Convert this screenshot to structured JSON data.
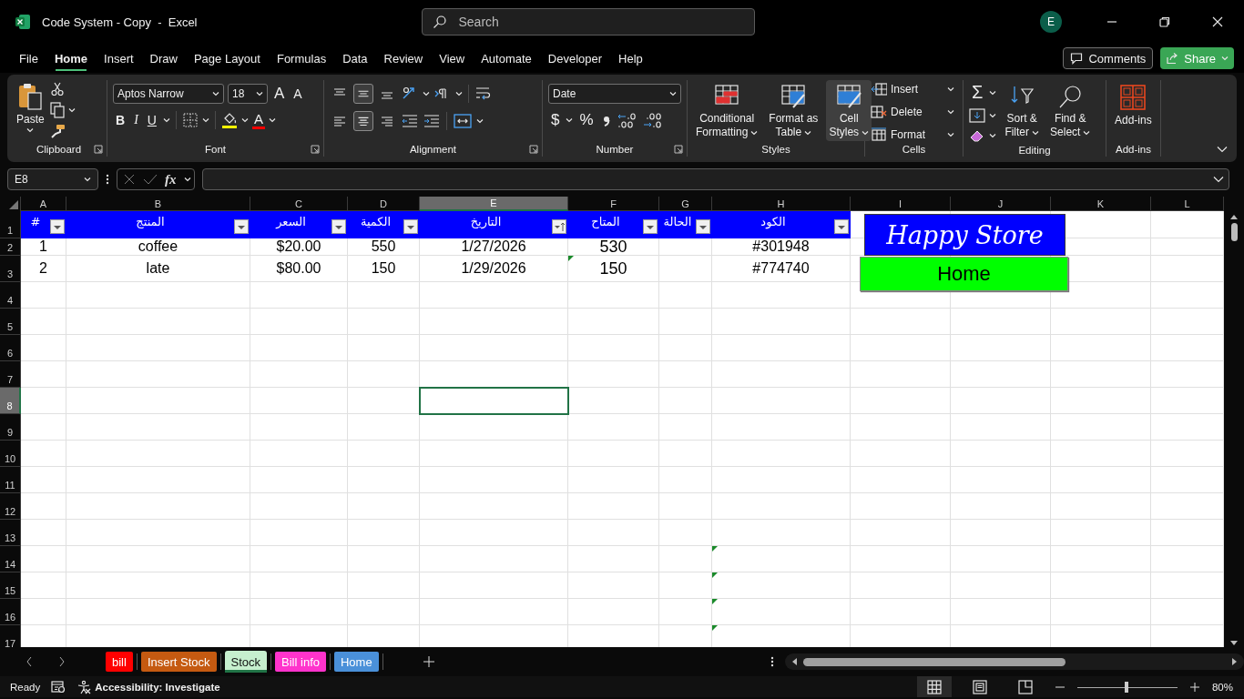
{
  "window": {
    "title": "Code System - Copy  -  Excel",
    "search_placeholder": "Search",
    "user_initial": "E"
  },
  "menu": {
    "tabs": [
      {
        "label": "File",
        "selected": false
      },
      {
        "label": "Home",
        "selected": true
      },
      {
        "label": "Insert",
        "selected": false
      },
      {
        "label": "Draw",
        "selected": false
      },
      {
        "label": "Page Layout",
        "selected": false
      },
      {
        "label": "Formulas",
        "selected": false
      },
      {
        "label": "Data",
        "selected": false
      },
      {
        "label": "Review",
        "selected": false
      },
      {
        "label": "View",
        "selected": false
      },
      {
        "label": "Automate",
        "selected": false
      },
      {
        "label": "Developer",
        "selected": false
      },
      {
        "label": "Help",
        "selected": false
      }
    ],
    "comments": "Comments",
    "share": "Share"
  },
  "ribbon": {
    "groups": [
      {
        "kind": "clipboard",
        "label": "Clipboard",
        "launcher": true,
        "paste": "Paste"
      },
      {
        "kind": "font",
        "label": "Font",
        "launcher": true,
        "font_name": "Aptos Narrow",
        "font_size": "18",
        "grow": "A",
        "shrink": "A",
        "styles": [
          "B",
          "I",
          "U"
        ],
        "font_color_glyph": "A"
      },
      {
        "kind": "alignment",
        "label": "Alignment",
        "launcher": true,
        "vertical": [
          {
            "selected": false
          },
          {
            "selected": true
          },
          {
            "selected": false
          }
        ],
        "horizontal": [
          {
            "selected": false
          },
          {
            "selected": true
          },
          {
            "selected": false
          }
        ]
      },
      {
        "kind": "number",
        "label": "Number",
        "launcher": true,
        "format": "Date",
        "currency": "$",
        "percent": "%"
      },
      {
        "kind": "styles",
        "label": "Styles",
        "buttons": [
          {
            "lines": [
              "Conditional",
              "Formatting"
            ],
            "highlighted": false
          },
          {
            "lines": [
              "Format as",
              "Table"
            ],
            "highlighted": false
          },
          {
            "lines": [
              "Cell",
              "Styles"
            ],
            "highlighted": true
          }
        ]
      },
      {
        "kind": "cells",
        "label": "Cells",
        "buttons": [
          "Insert",
          "Delete",
          "Format"
        ]
      },
      {
        "kind": "editing",
        "label": "Editing",
        "sum": "Σ",
        "buttons": [
          {
            "lines": [
              "Sort &",
              "Filter"
            ]
          },
          {
            "lines": [
              "Find &",
              "Select"
            ]
          }
        ]
      },
      {
        "kind": "addins",
        "label": "Add-ins",
        "button": "Add-ins"
      }
    ]
  },
  "formula_bar": {
    "name_box": "E8",
    "fx": "fx"
  },
  "sheet": {
    "columns": [
      {
        "letter": "A",
        "selected": false
      },
      {
        "letter": "B",
        "selected": false
      },
      {
        "letter": "C",
        "selected": false
      },
      {
        "letter": "D",
        "selected": false
      },
      {
        "letter": "E",
        "selected": true
      },
      {
        "letter": "F",
        "selected": false
      },
      {
        "letter": "G",
        "selected": false
      },
      {
        "letter": "H",
        "selected": false
      },
      {
        "letter": "I",
        "selected": false
      },
      {
        "letter": "J",
        "selected": false
      },
      {
        "letter": "K",
        "selected": false
      },
      {
        "letter": "L",
        "selected": false
      }
    ],
    "rows": [
      {
        "number": "1",
        "selected": false,
        "kind": "header",
        "cells": [
          {
            "text": "#",
            "sorted": false
          },
          {
            "text": "المنتج",
            "sorted": false
          },
          {
            "text": "السعر",
            "sorted": false
          },
          {
            "text": "الكمية",
            "sorted": false
          },
          {
            "text": "التاريخ",
            "sorted": true
          },
          {
            "text": "المتاح",
            "sorted": false
          },
          {
            "text": "الحالة",
            "sorted": false
          },
          {
            "text": "الكود",
            "sorted": false
          }
        ]
      },
      {
        "number": "2",
        "selected": false,
        "kind": "data",
        "cells": [
          {
            "text": "1",
            "error_mark": false
          },
          {
            "text": "coffee",
            "error_mark": false
          },
          {
            "text": "$20.00",
            "error_mark": false
          },
          {
            "text": "550",
            "error_mark": false
          },
          {
            "text": "1/27/2026",
            "error_mark": false
          },
          {
            "text": "530",
            "error_mark": false
          },
          null,
          {
            "text": "#301948",
            "error_mark": false
          }
        ]
      },
      {
        "number": "3",
        "selected": false,
        "kind": "data",
        "cells": [
          {
            "text": "2",
            "error_mark": false
          },
          {
            "text": "late",
            "error_mark": false
          },
          {
            "text": "$80.00",
            "error_mark": false
          },
          {
            "text": "150",
            "error_mark": false
          },
          {
            "text": "1/29/2026",
            "error_mark": false
          },
          {
            "text": "150",
            "error_mark": true
          },
          null,
          {
            "text": "#774740",
            "error_mark": false
          }
        ]
      },
      {
        "number": "4",
        "selected": false,
        "kind": "data",
        "cells": []
      },
      {
        "number": "5",
        "selected": false,
        "kind": "data",
        "cells": []
      },
      {
        "number": "6",
        "selected": false,
        "kind": "data",
        "cells": []
      },
      {
        "number": "7",
        "selected": false,
        "kind": "data",
        "cells": []
      },
      {
        "number": "8",
        "selected": true,
        "kind": "data",
        "cells": []
      },
      {
        "number": "9",
        "selected": false,
        "kind": "data",
        "cells": []
      },
      {
        "number": "10",
        "selected": false,
        "kind": "data",
        "cells": []
      },
      {
        "number": "11",
        "selected": false,
        "kind": "data",
        "cells": []
      },
      {
        "number": "12",
        "selected": false,
        "kind": "data",
        "cells": []
      },
      {
        "number": "13",
        "selected": false,
        "kind": "data",
        "cells": []
      },
      {
        "number": "14",
        "selected": false,
        "kind": "data",
        "cells": [
          null,
          null,
          null,
          null,
          null,
          null,
          null,
          {
            "error_mark": true
          }
        ]
      },
      {
        "number": "15",
        "selected": false,
        "kind": "data",
        "cells": [
          null,
          null,
          null,
          null,
          null,
          null,
          null,
          {
            "error_mark": true
          }
        ]
      },
      {
        "number": "16",
        "selected": false,
        "kind": "data",
        "cells": [
          null,
          null,
          null,
          null,
          null,
          null,
          null,
          {
            "error_mark": true
          }
        ]
      },
      {
        "number": "17",
        "selected": false,
        "kind": "data",
        "cells": [
          null,
          null,
          null,
          null,
          null,
          null,
          null,
          {
            "error_mark": true
          }
        ]
      }
    ],
    "shapes": [
      {
        "kind": "banner",
        "text": "Happy Store"
      },
      {
        "kind": "button",
        "text": "Home"
      }
    ]
  },
  "sheet_tabs": [
    {
      "label": "bill",
      "color": "#ff0000",
      "selected": false
    },
    {
      "label": "Insert Stock",
      "color": "#c55a11",
      "selected": false
    },
    {
      "label": "Stock",
      "color": "#c6efce",
      "selected": true
    },
    {
      "label": "Bill info",
      "color": "#ff33cc",
      "selected": false
    },
    {
      "label": "Home",
      "color": "#4a90d9",
      "selected": false
    }
  ],
  "status_bar": {
    "ready": "Ready",
    "accessibility": "Accessibility: Investigate",
    "views": [
      {
        "kind": "normal",
        "selected": true
      },
      {
        "kind": "page_layout",
        "selected": false
      },
      {
        "kind": "page_break",
        "selected": false
      }
    ],
    "zoom": {
      "level": 0.49,
      "label": "80%"
    }
  }
}
